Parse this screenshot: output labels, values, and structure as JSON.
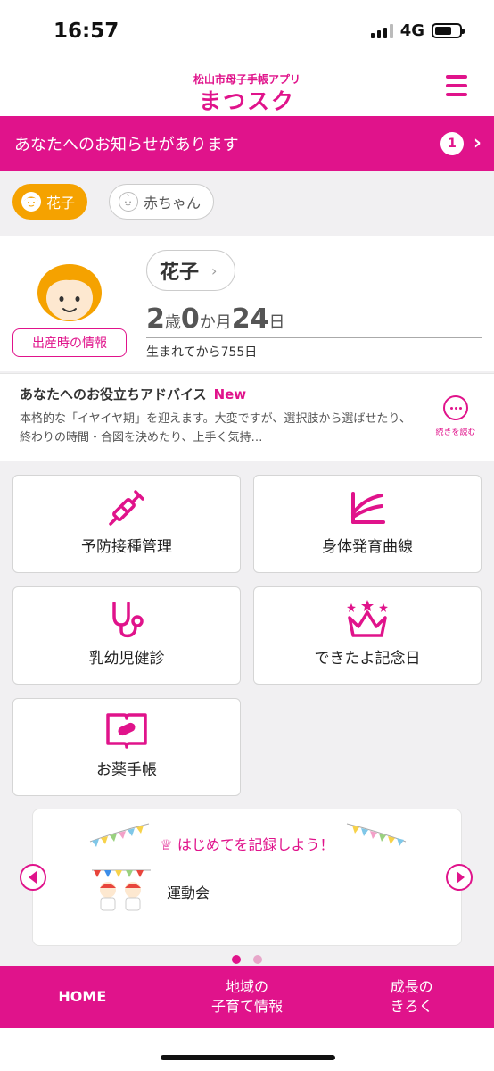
{
  "status_bar": {
    "time": "16:57",
    "network": "4G"
  },
  "header": {
    "subtitle": "松山市母子手帳アプリ",
    "title": "まつスク"
  },
  "notice": {
    "text": "あなたへのお知らせがあります",
    "count": "1"
  },
  "profiles": [
    {
      "label": "花子",
      "active": true
    },
    {
      "label": "赤ちゃん",
      "active": false
    }
  ],
  "child": {
    "name": "花子",
    "birth_info_label": "出産時の情報",
    "age_years": "2",
    "age_years_unit": "歳",
    "age_months": "0",
    "age_months_unit": "か月",
    "age_days": "24",
    "age_days_unit": "日",
    "days_since_birth": "生まれてから755日"
  },
  "advice": {
    "title": "あなたへのお役立ちアドバイス",
    "badge": "New",
    "body": "本格的な「イヤイヤ期」を迎えます。大変ですが、選択肢から選ばせたり、終わりの時間・合図を決めたり、上手く気持…",
    "more_label": "続きを読む"
  },
  "menu": [
    {
      "label": "予防接種管理",
      "icon": "syringe-icon"
    },
    {
      "label": "身体発育曲線",
      "icon": "growth-chart-icon"
    },
    {
      "label": "乳幼児健診",
      "icon": "stethoscope-icon"
    },
    {
      "label": "できたよ記念日",
      "icon": "crown-icon"
    },
    {
      "label": "お薬手帳",
      "icon": "medicine-book-icon"
    }
  ],
  "carousel": {
    "title": "はじめてを記録しよう！",
    "item": "運動会",
    "pages": 2,
    "current_page": 1
  },
  "bottom_nav": [
    {
      "label": "HOME"
    },
    {
      "label": "地域の\n子育て情報"
    },
    {
      "label": "成長の\nきろく"
    }
  ],
  "colors": {
    "accent": "#e0138b",
    "orange": "#f5a200"
  }
}
